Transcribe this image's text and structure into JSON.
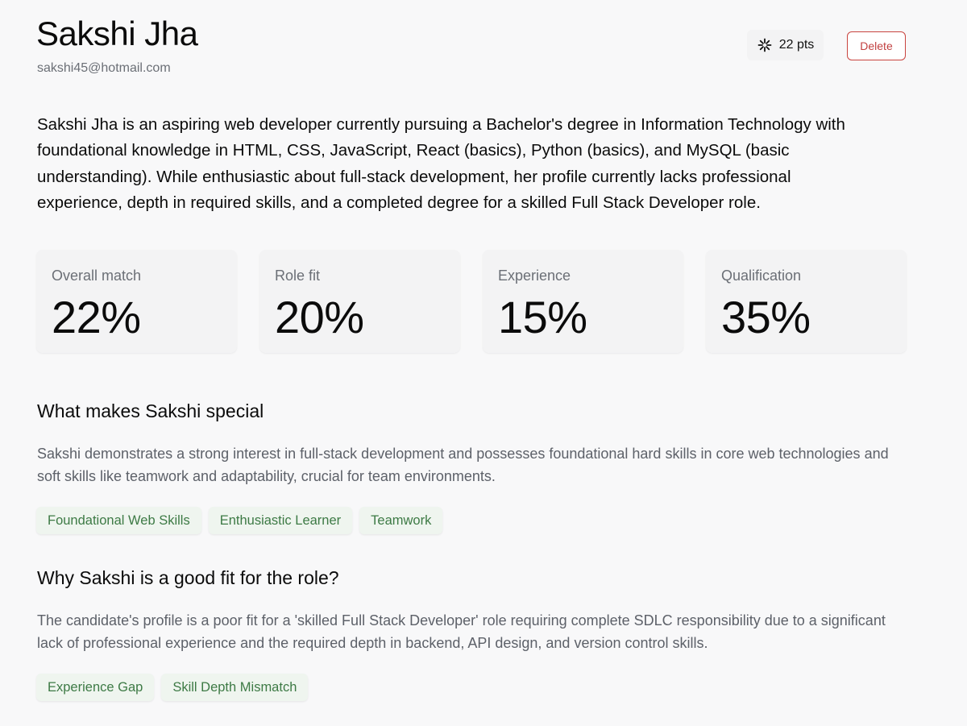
{
  "candidate": {
    "name": "Sakshi Jha",
    "email": "sakshi45@hotmail.com"
  },
  "points": {
    "label": "22 pts",
    "icon": "asterisk-sparkle-icon"
  },
  "actions": {
    "delete_label": "Delete"
  },
  "summary": "Sakshi Jha is an aspiring web developer currently pursuing a Bachelor's degree in Information Technology with foundational knowledge in HTML, CSS, JavaScript, React (basics), Python (basics), and MySQL (basic understanding). While enthusiastic about full-stack development, her profile currently lacks professional experience, depth in required skills, and a completed degree for a skilled Full Stack Developer role.",
  "metrics": [
    {
      "label": "Overall match",
      "value": "22%"
    },
    {
      "label": "Role fit",
      "value": "20%"
    },
    {
      "label": "Experience",
      "value": "15%"
    },
    {
      "label": "Qualification",
      "value": "35%"
    }
  ],
  "special": {
    "title": "What makes Sakshi special",
    "text": "Sakshi demonstrates a strong interest in full-stack development and possesses foundational hard skills in core web technologies and soft skills like teamwork and adaptability, crucial for team environments.",
    "tags": [
      "Foundational Web Skills",
      "Enthusiastic Learner",
      "Teamwork"
    ]
  },
  "fit": {
    "title": "Why Sakshi is a good fit for the role?",
    "text": "The candidate's profile is a poor fit for a 'skilled Full Stack Developer' role requiring complete SDLC responsibility due to a significant lack of professional experience and the required depth in backend, API design, and version control skills.",
    "tags": [
      "Experience Gap",
      "Skill Depth Mismatch"
    ]
  },
  "colors": {
    "background": "#f8f8f9",
    "delete_red": "#c24141",
    "tag_green_text": "#3d7a45",
    "tag_green_bg": "#eff5ef",
    "muted_text": "#6b6f76"
  }
}
